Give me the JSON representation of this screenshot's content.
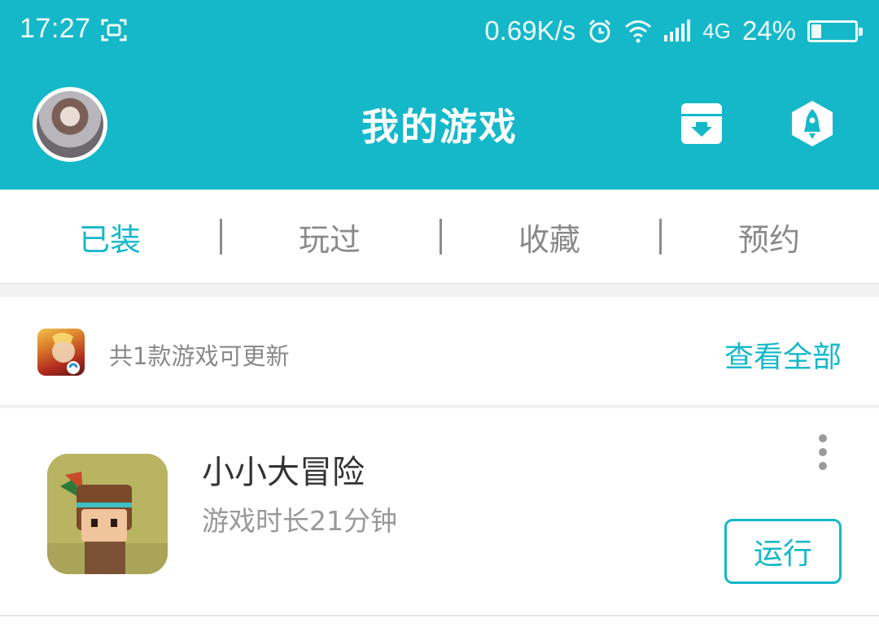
{
  "status_bar": {
    "time": "17:27",
    "net_speed": "0.69K/s",
    "network": "4G",
    "battery": "24%",
    "battery_level": 0.24,
    "icons": [
      "screenshot-icon",
      "alarm-icon",
      "wifi-icon",
      "signal-icon",
      "battery-icon"
    ]
  },
  "header": {
    "title": "我的游戏",
    "icons": [
      "download-box-icon",
      "rocket-icon"
    ],
    "accent_color": "#15b8c9"
  },
  "tabs": [
    {
      "label": "已装",
      "active": true
    },
    {
      "label": "玩过",
      "active": false
    },
    {
      "label": "收藏",
      "active": false
    },
    {
      "label": "预约",
      "active": false
    }
  ],
  "update_banner": {
    "text": "共1款游戏可更新",
    "action": "查看全部"
  },
  "games": [
    {
      "name": "小小大冒险",
      "playtime": "游戏时长21分钟",
      "action": "运行"
    }
  ]
}
